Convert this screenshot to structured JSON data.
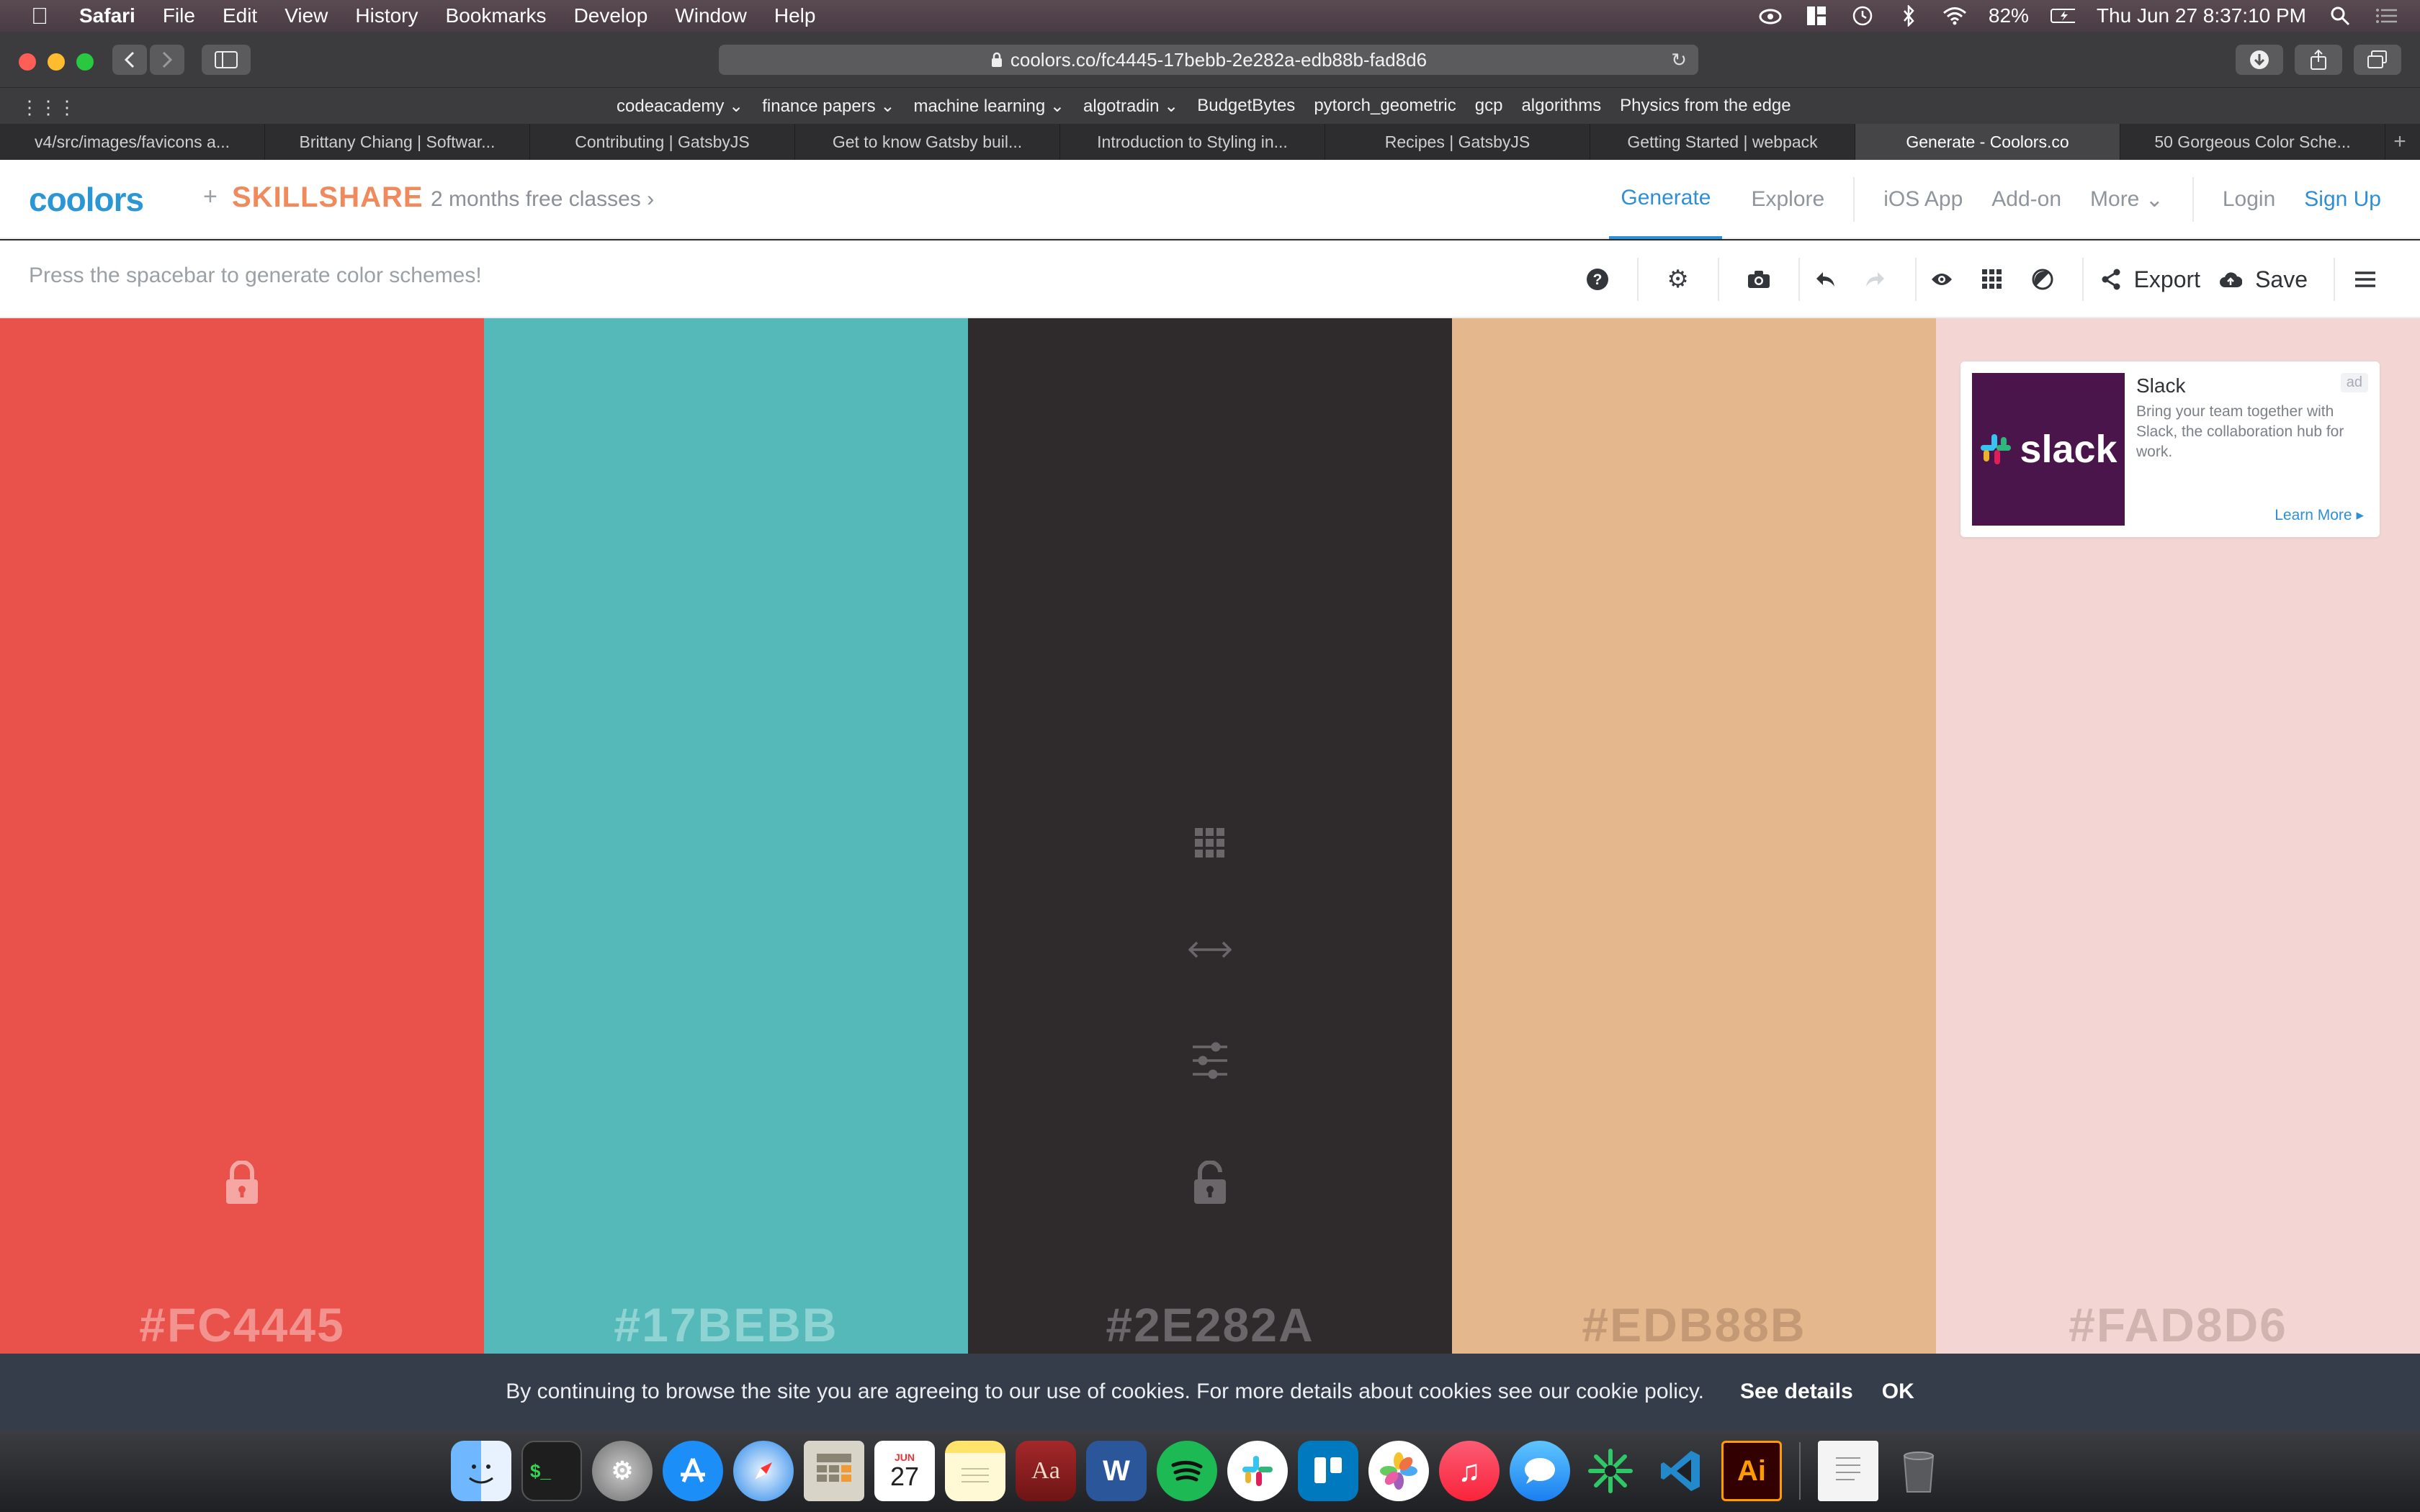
{
  "menubar": {
    "app": "Safari",
    "items": [
      "File",
      "Edit",
      "View",
      "History",
      "Bookmarks",
      "Develop",
      "Window",
      "Help"
    ],
    "battery": "82%",
    "clock": "Thu Jun 27  8:37:10 PM"
  },
  "browser": {
    "url": "coolors.co/fc4445-17bebb-2e282a-edb88b-fad8d6",
    "favorites": [
      "codeacademy",
      "finance papers",
      "machine learning",
      "algotradin",
      "BudgetBytes",
      "pytorch_geometric",
      "gcp",
      "algorithms",
      "Physics from the edge"
    ],
    "tabs": [
      {
        "label": "v4/src/images/favicons a..."
      },
      {
        "label": "Brittany Chiang | Softwar..."
      },
      {
        "label": "Contributing | GatsbyJS"
      },
      {
        "label": "Get to know Gatsby buil..."
      },
      {
        "label": "Introduction to Styling in..."
      },
      {
        "label": "Recipes | GatsbyJS"
      },
      {
        "label": "Getting Started | webpack"
      },
      {
        "label": "Generate - Coolors.co",
        "active": true
      },
      {
        "label": "50 Gorgeous Color Sche..."
      }
    ]
  },
  "header": {
    "logo": "coolors",
    "plus": "+",
    "partner": "SKILLSHARE",
    "promo": "2 months free classes",
    "nav": {
      "generate": "Generate",
      "explore": "Explore",
      "ios": "iOS App",
      "addon": "Add-on",
      "more": "More",
      "login": "Login",
      "signup": "Sign Up"
    }
  },
  "toolbar": {
    "hint": "Press the spacebar to generate color schemes!",
    "export": "Export",
    "save": "Save"
  },
  "palette": [
    {
      "hex": "#FC4445",
      "bg": "#e9514b",
      "text": "#f3938f",
      "locked": true
    },
    {
      "hex": "#17BEBB",
      "bg": "#54b9b8",
      "text": "#8fd4d3",
      "locked": false
    },
    {
      "hex": "#2E282A",
      "bg": "#2f2a2c",
      "text": "#6b6669",
      "locked": false
    },
    {
      "hex": "#EDB88B",
      "bg": "#e4b78d",
      "text": "#c49a76",
      "locked": false
    },
    {
      "hex": "#FAD8D6",
      "bg": "#f3d6d3",
      "text": "#d1b3b0",
      "locked": false
    }
  ],
  "ad": {
    "title": "Slack",
    "tag": "ad",
    "brand": "slack",
    "body": "Bring your team together with Slack, the collaboration hub for work.",
    "cta": "Learn More"
  },
  "cookie": {
    "message": "By continuing to browse the site you are agreeing to our use of cookies. For more details about cookies see our cookie policy.",
    "details": "See details",
    "ok": "OK"
  },
  "dock": {
    "calendar_month": "JUN",
    "calendar_day": "27",
    "illustrator": "Ai",
    "dictionary": "Aa",
    "word": "W"
  }
}
